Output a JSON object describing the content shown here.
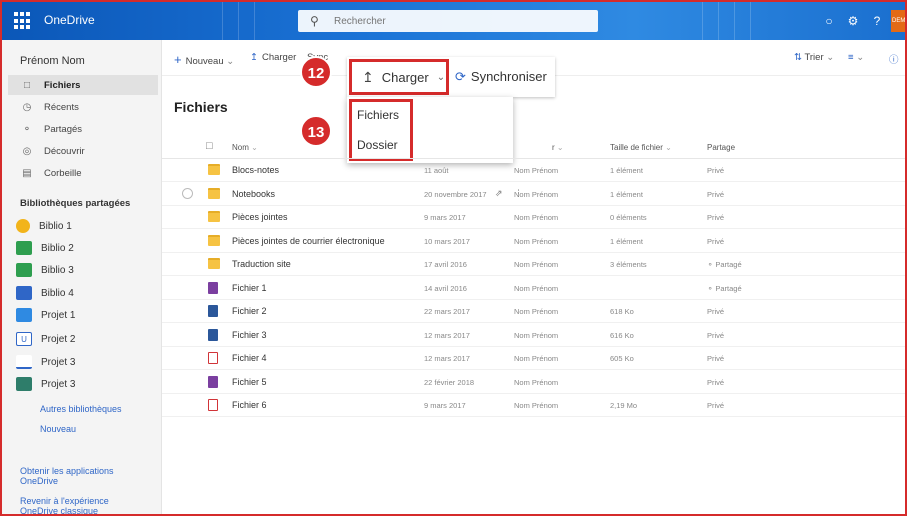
{
  "app": {
    "name": "OneDrive"
  },
  "search": {
    "placeholder": "Rechercher"
  },
  "user": {
    "name": "Prénom Nom",
    "avatar_text": "DEM"
  },
  "nav": {
    "items": [
      {
        "label": "Fichiers",
        "icon": "folder-icon",
        "active": true
      },
      {
        "label": "Récents",
        "icon": "clock-icon"
      },
      {
        "label": "Partagés",
        "icon": "people-icon"
      },
      {
        "label": "Découvrir",
        "icon": "compass-icon"
      },
      {
        "label": "Corbeille",
        "icon": "trash-icon"
      }
    ],
    "libraries_heading": "Bibliothèques partagées",
    "libraries": [
      {
        "label": "Biblio 1",
        "color": "#f2b41b"
      },
      {
        "label": "Biblio 2",
        "color": "#2e9e4f"
      },
      {
        "label": "Biblio 3",
        "color": "#2e9e4f"
      },
      {
        "label": "Biblio 4",
        "color": "#2f66c7"
      },
      {
        "label": "Projet 1",
        "color": "#2f8ae2"
      },
      {
        "label": "Projet 2",
        "color": "#2f66c7"
      },
      {
        "label": "Projet 3",
        "color": "#2f66c7"
      },
      {
        "label": "Projet 3",
        "color": "#2e7d6a"
      }
    ],
    "other_libraries": "Autres bibliothèques",
    "new_library": "Nouveau",
    "get_apps": "Obtenir les applications OneDrive",
    "classic": "Revenir à l'expérience OneDrive classique"
  },
  "toolbar": {
    "new_label": "Nouveau",
    "upload_label": "Charger",
    "sync_label": "Sync",
    "sort_label": "Trier"
  },
  "callout": {
    "step_upload": "12",
    "step_menu": "13",
    "upload_label": "Charger",
    "sync_label": "Synchroniser"
  },
  "upload_menu": {
    "files": "Fichiers",
    "folder": "Dossier"
  },
  "main": {
    "title": "Fichiers",
    "columns": {
      "name": "Nom",
      "modified_by": "r",
      "size": "Taille de fichier",
      "sharing": "Partage"
    },
    "rows": [
      {
        "name": "Blocs-notes",
        "type": "folder",
        "modified": "11 août",
        "by": "Nom Prénom",
        "size": "1 élément",
        "sharing": "Privé"
      },
      {
        "name": "Notebooks",
        "type": "folder",
        "modified": "20 novembre 2017",
        "by": "Nom Prénom",
        "size": "1 élément",
        "sharing": "Privé",
        "hover": true
      },
      {
        "name": "Pièces jointes",
        "type": "folder",
        "modified": "9 mars 2017",
        "by": "Nom Prénom",
        "size": "0 éléments",
        "sharing": "Privé"
      },
      {
        "name": "Pièces jointes de courrier électronique",
        "type": "folder",
        "modified": "10 mars 2017",
        "by": "Nom Prénom",
        "size": "1 élément",
        "sharing": "Privé"
      },
      {
        "name": "Traduction site",
        "type": "folder",
        "modified": "17 avril 2016",
        "by": "Nom Prénom",
        "size": "3 éléments",
        "sharing": "Partagé"
      },
      {
        "name": "Fichier 1",
        "type": "onenote",
        "modified": "14 avril 2016",
        "by": "Nom Prénom",
        "size": "",
        "sharing": "Partagé"
      },
      {
        "name": "Fichier 2",
        "type": "word",
        "modified": "22 mars 2017",
        "by": "Nom Prénom",
        "size": "618 Ko",
        "sharing": "Privé"
      },
      {
        "name": "Fichier 3",
        "type": "word",
        "modified": "12 mars 2017",
        "by": "Nom Prénom",
        "size": "616 Ko",
        "sharing": "Privé"
      },
      {
        "name": "Fichier 4",
        "type": "pdf",
        "modified": "12 mars 2017",
        "by": "Nom Prénom",
        "size": "605 Ko",
        "sharing": "Privé"
      },
      {
        "name": "Fichier 5",
        "type": "onenote",
        "modified": "22 février 2018",
        "by": "Nom Prénom",
        "size": "",
        "sharing": "Privé"
      },
      {
        "name": "Fichier 6",
        "type": "pdf",
        "modified": "9 mars 2017",
        "by": "Nom Prénom",
        "size": "2,19 Mo",
        "sharing": "Privé"
      }
    ]
  },
  "colors": {
    "accent": "#2f66c7",
    "highlight": "#d52b2b",
    "topbar": "#0f62c4"
  }
}
